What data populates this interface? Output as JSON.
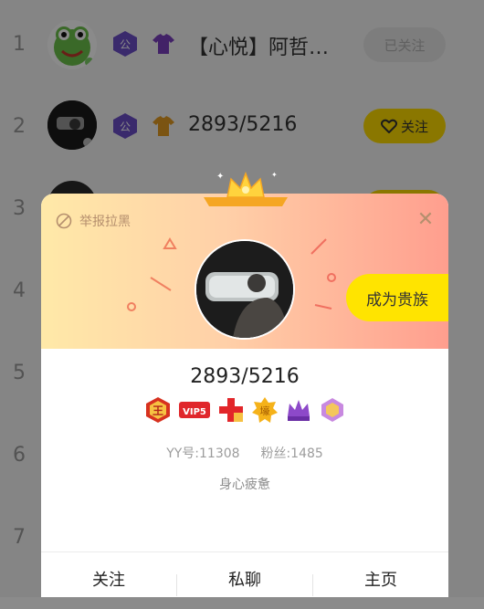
{
  "list": {
    "ranks": [
      "1",
      "2",
      "3",
      "4",
      "5",
      "6",
      "7"
    ],
    "rows": [
      {
        "rank": "1",
        "name": "【心悦】阿哲…",
        "follow_label": "已关注"
      },
      {
        "rank": "2",
        "name": "2893/5216",
        "follow_label": "关注"
      }
    ]
  },
  "popup": {
    "report_label": "举报拉黑",
    "close_icon": "close-icon",
    "noble_button": "成为贵族",
    "username": "2893/5216",
    "badge_labels": {
      "vip": "VIP5",
      "king": "王",
      "hao": "壕"
    },
    "yy_number": "YY号:11308",
    "fans": "粉丝:1485",
    "signature": "身心疲惫",
    "actions": {
      "follow": "关注",
      "chat": "私聊",
      "home": "主页"
    }
  },
  "colors": {
    "accent_yellow": "#ffdd00",
    "popup_gradient_start": "#ffe9a8",
    "popup_gradient_end": "#ff9e8e"
  }
}
